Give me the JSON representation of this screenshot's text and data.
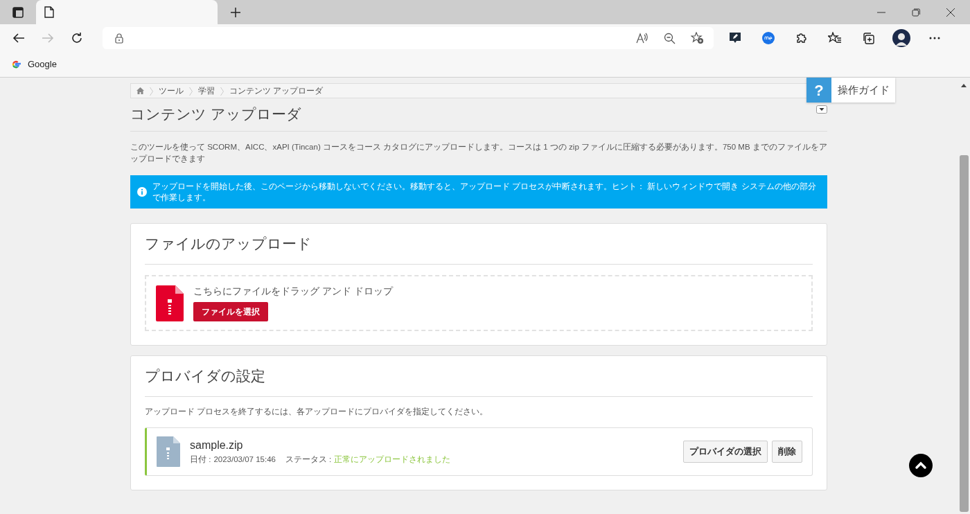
{
  "browser": {
    "bookmarks": [
      {
        "label": "Google"
      }
    ]
  },
  "breadcrumb": [
    "ツール",
    "学習",
    "コンテンツ アップローダ"
  ],
  "help": {
    "icon": "?",
    "label": "操作ガイド"
  },
  "page_title": "コンテンツ アップローダ",
  "description": "このツールを使って SCORM、AICC、xAPI (Tincan) コースをコース カタログにアップロードします。コースは 1 つの zip ファイルに圧縮する必要があります。750 MB までのファイルをアップロードできます",
  "alert": "アップロードを開始した後、このページから移動しないでください。移動すると、アップロード プロセスが中断されます。ヒント： 新しいウィンドウで開き システムの他の部分で作業します。",
  "upload_card": {
    "title": "ファイルのアップロード",
    "dropzone_text": "こちらにファイルをドラッグ アンド ドロップ",
    "select_button": "ファイルを選択"
  },
  "provider_card": {
    "title": "プロバイダの設定",
    "instruction": "アップロード プロセスを終了するには、各アップロードにプロバイダを指定してください。",
    "files": [
      {
        "name": "sample.zip",
        "date_label": "日付 :",
        "date": "2023/03/07 15:46",
        "status_label": "ステータス :",
        "status": "正常にアップロードされました",
        "color": "#8cc63f",
        "buttons": [
          "プロバイダの選択",
          "削除"
        ]
      }
    ]
  }
}
